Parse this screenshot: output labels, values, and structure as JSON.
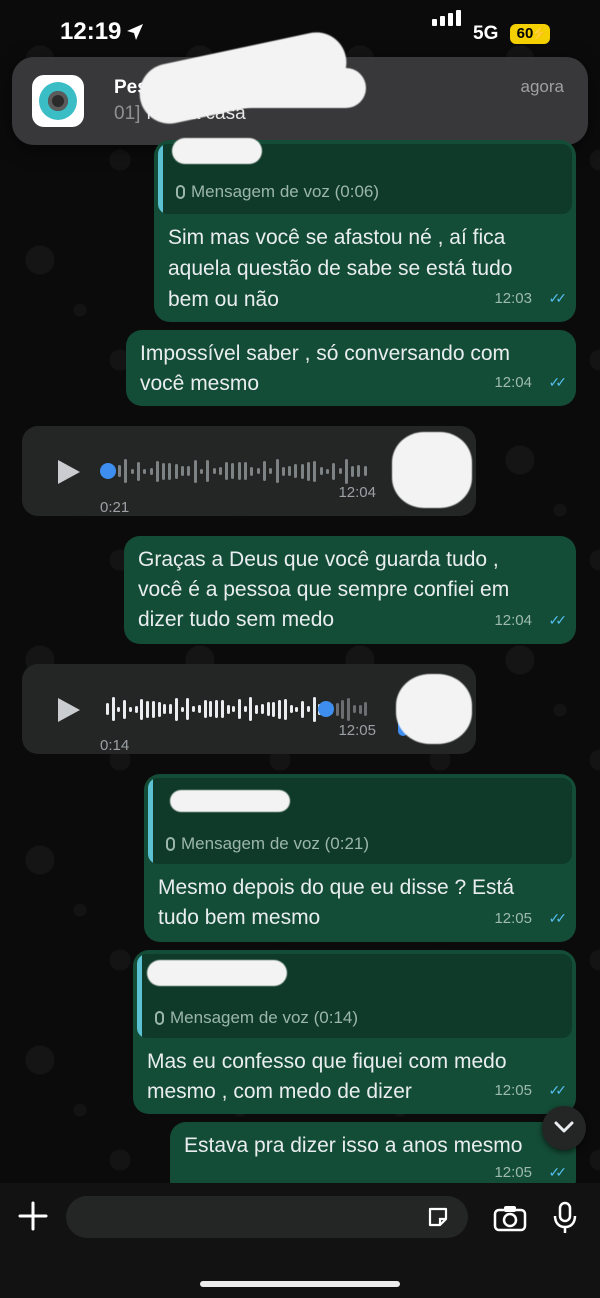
{
  "status_bar": {
    "time": "12:19",
    "network": "5G",
    "battery": "60"
  },
  "notification": {
    "title": "Pes",
    "body": "Nossa casa",
    "body_prefix": "01]",
    "time": "agora"
  },
  "messages": {
    "m1": {
      "reply_label": "Mensagem de voz (0:06)",
      "line1": "Sim mas você se afastou né , aí fica",
      "line2": "aquela questão de sabe se está tudo",
      "line3": "bem ou não",
      "time": "12:03"
    },
    "m2": {
      "line1": "Impossível saber , só conversando com",
      "line2": "você mesmo",
      "time": "12:04"
    },
    "v1": {
      "duration": "0:21",
      "time": "12:04"
    },
    "m3": {
      "line1": "Graças a Deus que você guarda tudo ,",
      "line2": "você é a pessoa que sempre confiei em",
      "line3": "dizer tudo sem medo",
      "time": "12:04"
    },
    "v2": {
      "duration": "0:14",
      "time": "12:05"
    },
    "m4": {
      "reply_label": "Mensagem de voz (0:21)",
      "line1": "Mesmo depois do que eu disse ? Está",
      "line2": "tudo bem mesmo",
      "time": "12:05"
    },
    "m5": {
      "reply_label": "Mensagem de voz (0:14)",
      "line1": "Mas eu confesso que fiquei com medo",
      "line2": "mesmo , com medo de dizer",
      "time": "12:05"
    },
    "m6": {
      "line1": "Estava pra dizer isso a anos mesmo",
      "time": "12:05"
    }
  },
  "icons": {
    "location": "location-arrow-icon",
    "scroll_down": "chevron-down-icon",
    "attach": "plus-icon",
    "sticker": "sticker-icon",
    "camera": "camera-icon",
    "mic": "microphone-icon"
  },
  "colors": {
    "outgoing_bubble": "#144d37",
    "incoming_bubble": "#242626",
    "read_ticks": "#53bdeb",
    "battery": "#f5d000",
    "voice_accent": "#3e8ef0"
  }
}
